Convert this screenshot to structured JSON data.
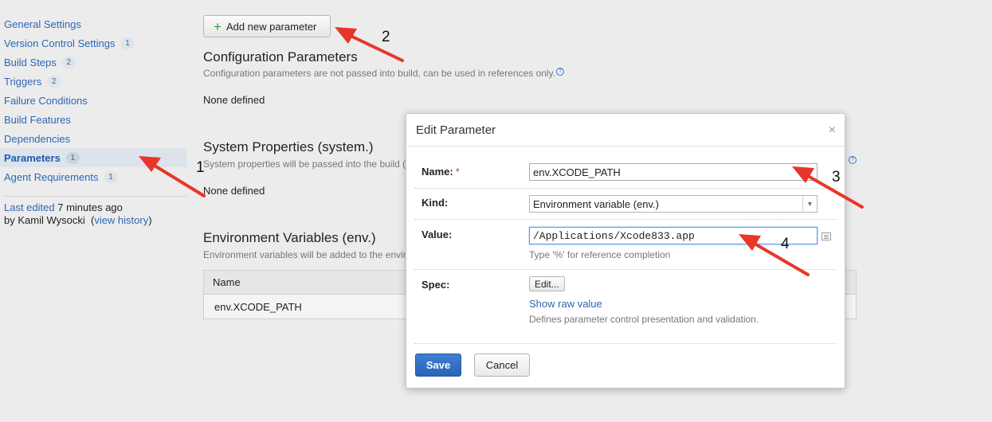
{
  "sidebar": {
    "items": [
      {
        "label": "General Settings",
        "badge": ""
      },
      {
        "label": "Version Control Settings",
        "badge": "1"
      },
      {
        "label": "Build Steps",
        "badge": "2"
      },
      {
        "label": "Triggers",
        "badge": "2"
      },
      {
        "label": "Failure Conditions",
        "badge": ""
      },
      {
        "label": "Build Features",
        "badge": ""
      },
      {
        "label": "Dependencies",
        "badge": ""
      },
      {
        "label": "Parameters",
        "badge": "1",
        "active": true
      },
      {
        "label": "Agent Requirements",
        "badge": "1"
      }
    ],
    "last_edited": {
      "link_text": "Last edited",
      "time": "7 minutes ago",
      "by_prefix": "by Kamil Wysocki",
      "open_paren": "(",
      "history_link": "view history",
      "close_paren": ")"
    }
  },
  "toolbar": {
    "add_parameter_label": "Add new parameter"
  },
  "sections": {
    "config": {
      "title": "Configuration Parameters",
      "desc": "Configuration parameters are not passed into build, can be used in references only.",
      "empty": "None defined"
    },
    "system": {
      "title": "System Properties (system.)",
      "desc": "System properties will be passed into the build (",
      "empty": "None defined"
    },
    "env": {
      "title": "Environment Variables (env.)",
      "desc": "Environment variables will be added to the enviro",
      "column_name": "Name",
      "rows": [
        "env.XCODE_PATH"
      ]
    }
  },
  "dialog": {
    "title": "Edit Parameter",
    "close_glyph": "×",
    "name_label": "Name:",
    "required_mark": "*",
    "name_value": "env.XCODE_PATH",
    "kind_label": "Kind:",
    "kind_value": "Environment variable (env.)",
    "value_label": "Value:",
    "value_value": "/Applications/Xcode833.app",
    "value_hint": "Type '%' for reference completion",
    "spec_label": "Spec:",
    "spec_edit_button": "Edit...",
    "show_raw_link": "Show raw value",
    "spec_hint": "Defines parameter control presentation and validation.",
    "save_label": "Save",
    "cancel_label": "Cancel"
  },
  "annotations": {
    "n1": "1",
    "n2": "2",
    "n3": "3",
    "n4": "4",
    "arrow_color": "#e8362a"
  }
}
